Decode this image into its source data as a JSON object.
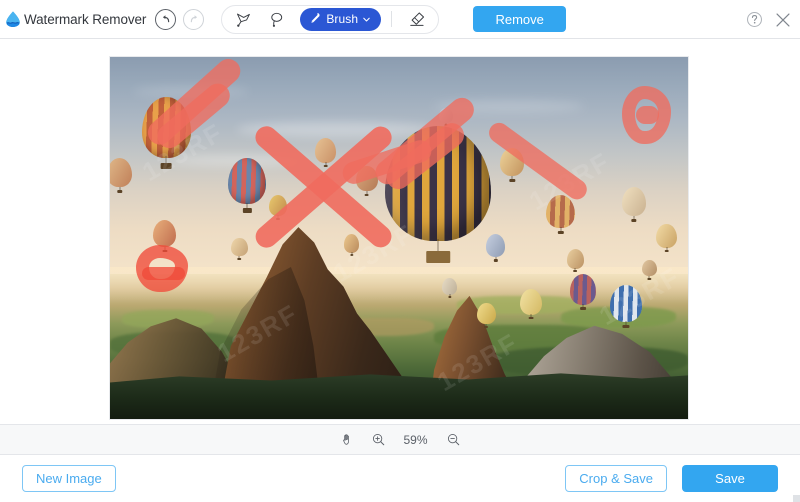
{
  "app": {
    "title": "Watermark Remover",
    "logo_icon": "water-drop-logo",
    "accent_blue": "#33a6f0",
    "brush_blue": "#2b57d4",
    "stroke_red": "#ef6b5e"
  },
  "header": {
    "undo": {
      "icon": "undo-arrow-icon",
      "label": "Undo",
      "enabled": true
    },
    "redo": {
      "icon": "redo-arrow-icon",
      "label": "Redo",
      "enabled": false
    },
    "tools": [
      {
        "id": "polygon-lasso",
        "icon": "polygon-lasso-icon",
        "label": "Polygonal Lasso"
      },
      {
        "id": "free-lasso",
        "icon": "lasso-icon",
        "label": "Lasso"
      }
    ],
    "brush": {
      "icon": "brush-icon",
      "label": "Brush",
      "chevron": "chevron-down-icon"
    },
    "eraser": {
      "icon": "eraser-icon",
      "label": "Eraser"
    },
    "remove_label": "Remove",
    "help": {
      "icon": "question-circle-icon",
      "label": "Help"
    },
    "close": {
      "icon": "close-icon",
      "label": "Close"
    }
  },
  "canvas": {
    "photo_alt": "Hot air balloons over Cappadocia rock formation at sunrise",
    "watermark_text": "123RF",
    "strokes_count": 6
  },
  "zoombar": {
    "hand": {
      "icon": "hand-icon",
      "label": "Pan"
    },
    "zoom_in": {
      "icon": "zoom-in-icon",
      "label": "Zoom in"
    },
    "zoom_out": {
      "icon": "zoom-out-icon",
      "label": "Zoom out"
    },
    "zoom_level": "59%"
  },
  "footer": {
    "new_image_label": "New Image",
    "crop_save_label": "Crop & Save",
    "save_label": "Save"
  }
}
